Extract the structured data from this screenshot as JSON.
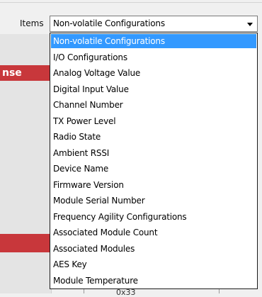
{
  "left_panel": {
    "band_text": "nse"
  },
  "items_control": {
    "label": "Items",
    "selected_value": "Non-volatile Configurations",
    "options": [
      "Non-volatile Configurations",
      "I/O Configurations",
      "Analog Voltage Value",
      "Digital Input Value",
      "Channel Number",
      "TX Power Level",
      "Radio State",
      "Ambient RSSI",
      "Device Name",
      "Firmware Version",
      "Module Serial Number",
      "Frequency Agility Configurations",
      "Associated Module Count",
      "Associated Modules",
      "AES Key",
      "Module Temperature"
    ],
    "highlighted_index": 0
  },
  "partial_below": {
    "text": "0x33"
  },
  "colors": {
    "selection": "#3399ff",
    "accent_red": "#c8373b"
  }
}
